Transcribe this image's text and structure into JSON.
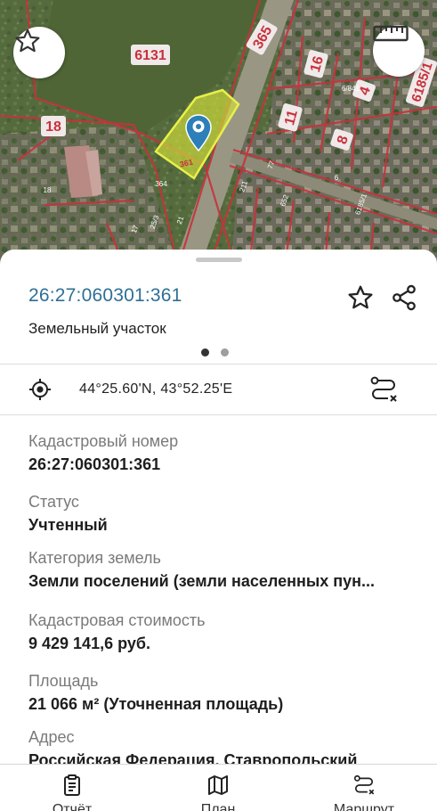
{
  "map": {
    "labels": {
      "block_6131": "6131",
      "block_365": "365",
      "block_18": "18",
      "block_16": "16",
      "block_4": "4",
      "block_6185_1": "6185/1",
      "block_11": "11",
      "block_8": "8",
      "plot_361": "361",
      "plot_364": "364",
      "plot_21": "21",
      "plot_211": "211",
      "plot_77": "77",
      "plot_6": "6",
      "plot_18b": "18",
      "plot_17": "17",
      "plot_253": "25/3",
      "plot_652": "652",
      "plot_6185_1b": "6185/1",
      "plot_6_841": "6/841"
    },
    "colors": {
      "selection_fill": "#d4e03a",
      "boundary": "#c8323c",
      "marker": "#2c7fb8"
    },
    "favorite_icon": "star-outline-icon",
    "ruler_icon": "ruler-icon"
  },
  "card": {
    "cadastral_number": "26:27:060301:361",
    "object_type": "Земельный участок",
    "coordinates": "44°25.60'N, 43°52.25'E",
    "page_dots": 2,
    "active_dot": 1
  },
  "fields": [
    {
      "label": "Кадастровый номер",
      "value": "26:27:060301:361"
    },
    {
      "label": "Статус",
      "value": "Учтенный"
    },
    {
      "label": "Категория земель",
      "value": "Земли поселений (земли населенных пун..."
    },
    {
      "label": "Кадастровая стоимость",
      "value": "9 429 141,6 руб."
    },
    {
      "label": "Площадь",
      "value": "21 066 м² (Уточненная площадь)"
    },
    {
      "label": "Адрес",
      "value": "Российская Федерация, Ставропольский"
    }
  ],
  "nav": [
    {
      "label": "Отчёт",
      "icon": "report-icon"
    },
    {
      "label": "План",
      "icon": "map-icon"
    },
    {
      "label": "Маршрут",
      "icon": "route-icon"
    }
  ]
}
